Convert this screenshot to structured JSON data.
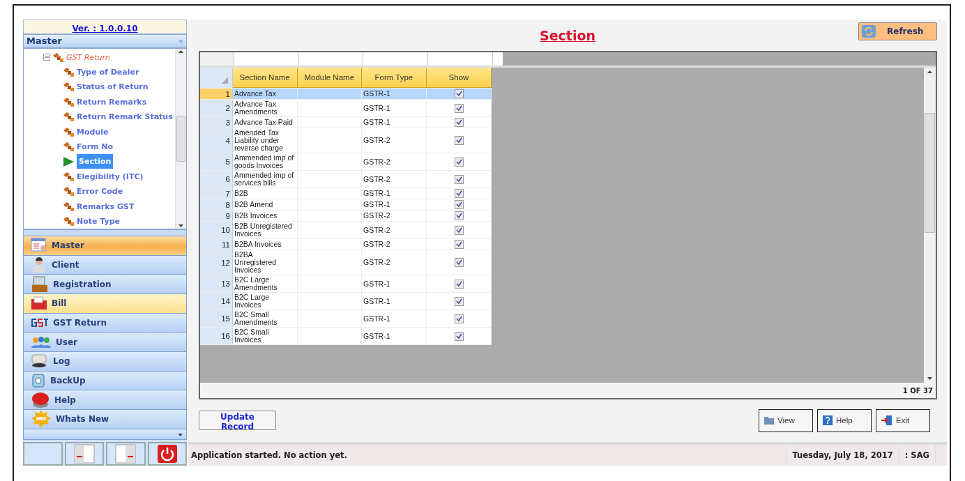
{
  "app": {
    "version": "Ver. : 1.0.0.10"
  },
  "tree": {
    "title": "Master",
    "collapse_glyph": "«",
    "items": [
      {
        "label": "GST Return",
        "expanded": true,
        "selected": false,
        "children": [
          {
            "label": "Type of Dealer",
            "selected": false
          },
          {
            "label": "Status of Return",
            "selected": false
          },
          {
            "label": "Return Remarks",
            "selected": false
          },
          {
            "label": "Return Remark Status",
            "selected": false
          },
          {
            "label": "Module",
            "selected": false
          },
          {
            "label": "Form No",
            "selected": false
          },
          {
            "label": "Section",
            "selected": true
          },
          {
            "label": "Elegibility (ITC)",
            "selected": false
          },
          {
            "label": "Error Code",
            "selected": false
          },
          {
            "label": "Remarks GST",
            "selected": false
          },
          {
            "label": "Note Type",
            "selected": false
          }
        ]
      }
    ]
  },
  "nav": [
    {
      "label": "Master",
      "kind": "master",
      "selected": true,
      "hovered": false
    },
    {
      "label": "Client",
      "kind": "client",
      "selected": false,
      "hovered": false
    },
    {
      "label": "Registration",
      "kind": "register",
      "selected": false,
      "hovered": false
    },
    {
      "label": "Bill",
      "kind": "bill",
      "selected": false,
      "hovered": true
    },
    {
      "label": "GST Return",
      "kind": "gst",
      "selected": false,
      "hovered": false
    },
    {
      "label": "User",
      "kind": "user",
      "selected": false,
      "hovered": false
    },
    {
      "label": "Log",
      "kind": "log",
      "selected": false,
      "hovered": false
    },
    {
      "label": "BackUp",
      "kind": "backup",
      "selected": false,
      "hovered": false
    },
    {
      "label": "Help",
      "kind": "help",
      "selected": false,
      "hovered": false
    },
    {
      "label": "Whats New",
      "kind": "new",
      "selected": false,
      "hovered": false
    }
  ],
  "title": "Section",
  "refresh_button": "Refresh",
  "table": {
    "columns": [
      "Section Name",
      "Module Name",
      "Form Type",
      "Show"
    ],
    "rows": [
      {
        "num": "1",
        "section": "Advance Tax",
        "form": "GSTR-1",
        "show": true,
        "selected": true
      },
      {
        "num": "2",
        "section": "Advance Tax Amendments",
        "form": "GSTR-1",
        "show": true,
        "selected": false
      },
      {
        "num": "3",
        "section": "Advance Tax Paid",
        "form": "GSTR-1",
        "show": true,
        "selected": false
      },
      {
        "num": "4",
        "section": "Amended Tax Liability under reverse charge",
        "form": "GSTR-2",
        "show": true,
        "selected": false
      },
      {
        "num": "5",
        "section": "Ammended imp of goods Invoices",
        "form": "GSTR-2",
        "show": true,
        "selected": false
      },
      {
        "num": "6",
        "section": "Ammended imp of services bills",
        "form": "GSTR-2",
        "show": true,
        "selected": false
      },
      {
        "num": "7",
        "section": "B2B",
        "form": "GSTR-1",
        "show": true,
        "selected": false
      },
      {
        "num": "8",
        "section": "B2B Amend",
        "form": "GSTR-1",
        "show": true,
        "selected": false
      },
      {
        "num": "9",
        "section": "B2B Invoices",
        "form": "GSTR-2",
        "show": true,
        "selected": false
      },
      {
        "num": "10",
        "section": "B2B Unregistered Invoices",
        "form": "GSTR-2",
        "show": true,
        "selected": false
      },
      {
        "num": "11",
        "section": "B2BA Invoices",
        "form": "GSTR-2",
        "show": true,
        "selected": false
      },
      {
        "num": "12",
        "section": "B2BA Unregistered Invoices",
        "form": "GSTR-2",
        "show": true,
        "selected": false
      },
      {
        "num": "13",
        "section": "B2C Large Amendments",
        "form": "GSTR-1",
        "show": true,
        "selected": false
      },
      {
        "num": "14",
        "section": "B2C Large Invoices",
        "form": "GSTR-1",
        "show": true,
        "selected": false
      },
      {
        "num": "15",
        "section": "B2C Small Amendments",
        "form": "GSTR-1",
        "show": true,
        "selected": false
      },
      {
        "num": "16",
        "section": "B2C Small Invoices",
        "form": "GSTR-1",
        "show": true,
        "selected": false
      }
    ],
    "pager": "1 OF 37"
  },
  "update_button": "Update Record",
  "buttons": [
    {
      "label": "View",
      "kind": "view"
    },
    {
      "label": "Help",
      "kind": "help"
    },
    {
      "label": "Exit",
      "kind": "exit"
    }
  ],
  "status_bar": {
    "message": "Application started. No action yet.",
    "date": "Tuesday, July 18, 2017",
    "user": ": SAG"
  }
}
